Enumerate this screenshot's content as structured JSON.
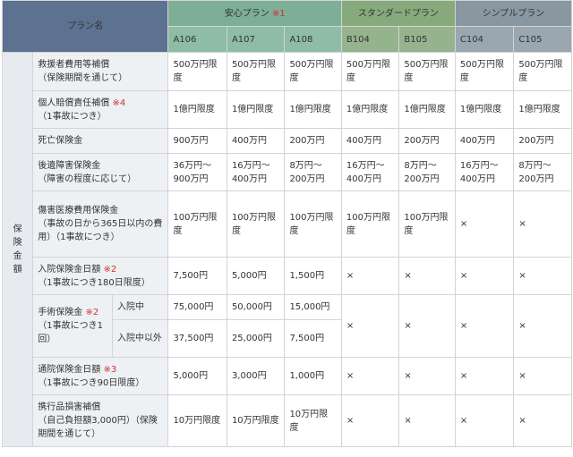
{
  "header": {
    "plan_name": "プラン名",
    "groups": [
      {
        "name": "安心プラン",
        "note": "※1"
      },
      {
        "name": "スタンダードプラン",
        "note": ""
      },
      {
        "name": "シンプルプラン",
        "note": ""
      }
    ],
    "codes": [
      "A106",
      "A107",
      "A108",
      "B104",
      "B105",
      "C104",
      "C105"
    ]
  },
  "side_label": [
    "保",
    "険",
    "金",
    "額"
  ],
  "rows": [
    {
      "label": "救援者費用等補償",
      "detail": "（保険期間を通じて）",
      "note": "",
      "values": [
        "500万円限度",
        "500万円限度",
        "500万円限度",
        "500万円限度",
        "500万円限度",
        "500万円限度",
        "500万円限度"
      ]
    },
    {
      "label": "個人賠償責任補償",
      "detail": "（1事故につき）",
      "note": "※4",
      "values": [
        "1億円限度",
        "1億円限度",
        "1億円限度",
        "1億円限度",
        "1億円限度",
        "1億円限度",
        "1億円限度"
      ]
    },
    {
      "label": "死亡保険金",
      "detail": "",
      "note": "",
      "values": [
        "900万円",
        "400万円",
        "200万円",
        "400万円",
        "200万円",
        "400万円",
        "200万円"
      ]
    },
    {
      "label": "後遺障害保険金",
      "detail": "（障害の程度に応じて）",
      "note": "",
      "values": [
        "36万円～900万円",
        "16万円～400万円",
        "8万円～200万円",
        "16万円～400万円",
        "8万円～200万円",
        "16万円～400万円",
        "8万円～200万円"
      ]
    },
    {
      "label": "傷害医療費用保険金",
      "detail": "（事故の日から365日以内の費用）（1事故につき）",
      "note": "",
      "values": [
        "100万円限度",
        "100万円限度",
        "100万円限度",
        "100万円限度",
        "100万円限度",
        "×",
        "×"
      ]
    },
    {
      "label": "入院保険金日額",
      "detail": "（1事故につき180日限度）",
      "note": "※2",
      "values": [
        "7,500円",
        "5,000円",
        "1,500円",
        "×",
        "×",
        "×",
        "×"
      ]
    }
  ],
  "surgery": {
    "label": "手術保険金",
    "note": "※2",
    "detail": "（1事故につき1回）",
    "sub_rows": [
      {
        "label": "入院中",
        "values": [
          "75,000円",
          "50,000円",
          "15,000円"
        ]
      },
      {
        "label": "入院中以外",
        "values": [
          "37,500円",
          "25,000円",
          "7,500円"
        ]
      }
    ],
    "other_values": [
      "×",
      "×",
      "×",
      "×"
    ]
  },
  "rows_after": [
    {
      "label": "通院保険金日額",
      "detail": "（1事故につき90日限度）",
      "note": "※3",
      "values": [
        "5,000円",
        "3,000円",
        "1,000円",
        "×",
        "×",
        "×",
        "×"
      ]
    },
    {
      "label": "携行品損害補償",
      "detail": "（自己負担額3,000円）（保険期間を通じて）",
      "note": "",
      "values": [
        "10万円限度",
        "10万円限度",
        "10万円限度",
        "×",
        "×",
        "×",
        "×"
      ]
    }
  ]
}
